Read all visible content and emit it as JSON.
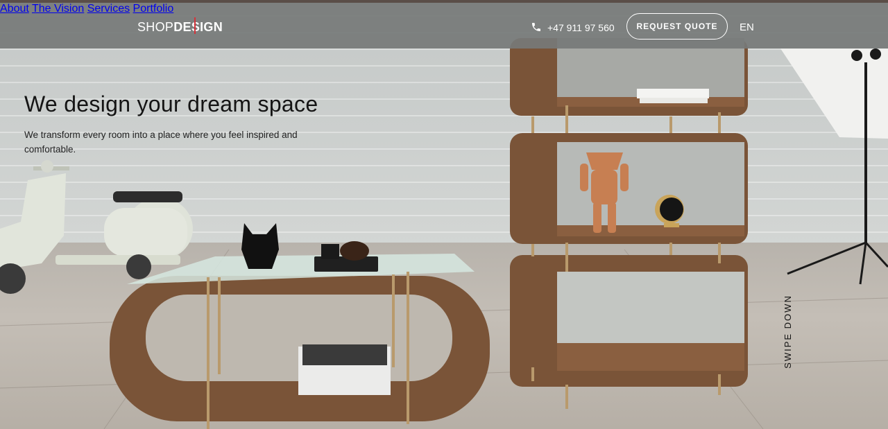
{
  "brand": {
    "logo_part1": "SHOP",
    "logo_part2": "DESIGN"
  },
  "nav": {
    "items": [
      {
        "label": "About"
      },
      {
        "label": "The Vision"
      },
      {
        "label": "Services"
      },
      {
        "label": "Portfolio"
      }
    ],
    "phone": "+47 911 97 560",
    "cta": "REQUEST QUOTE",
    "language": "EN"
  },
  "hero": {
    "title": "We design your dream space",
    "subtitle": "We transform every room into a place where you feel inspired and comfortable.",
    "scroll_hint": "SWIPE DOWN"
  },
  "colors": {
    "accent": "#d4333b",
    "navbar": "#767978",
    "text_dark": "#141414"
  }
}
